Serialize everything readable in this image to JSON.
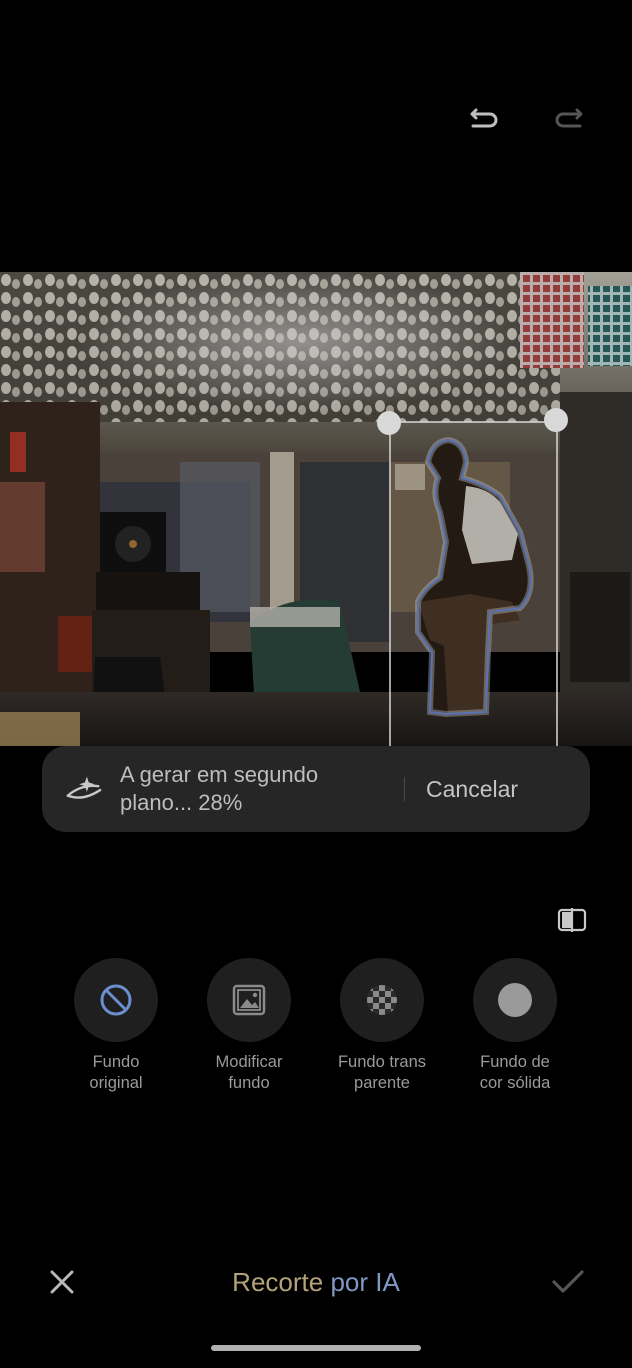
{
  "toolbar": {
    "undo_icon": "undo-icon",
    "redo_icon": "redo-icon"
  },
  "toast": {
    "icon": "sparkle-icon",
    "line1": "A gerar em segundo",
    "line2": "plano... 28%",
    "progress_percent": 28,
    "cancel_label": "Cancelar"
  },
  "options": [
    {
      "icon": "no-background-icon",
      "line1": "Fundo",
      "line2": "original"
    },
    {
      "icon": "image-icon",
      "line1": "Modificar",
      "line2": "fundo"
    },
    {
      "icon": "checkerboard-icon",
      "line1": "Fundo trans",
      "line2": "parente"
    },
    {
      "icon": "solid-circle-icon",
      "line1": "Fundo de",
      "line2": "cor sólida"
    }
  ],
  "bottom": {
    "title_part1": "Recorte ",
    "title_part2": "por IA",
    "close_icon": "close-icon",
    "confirm_icon": "check-icon"
  },
  "colors": {
    "accent_gold": "#b4a27a",
    "accent_blue": "#8298c4",
    "selection_blue": "#6d8bd8"
  }
}
